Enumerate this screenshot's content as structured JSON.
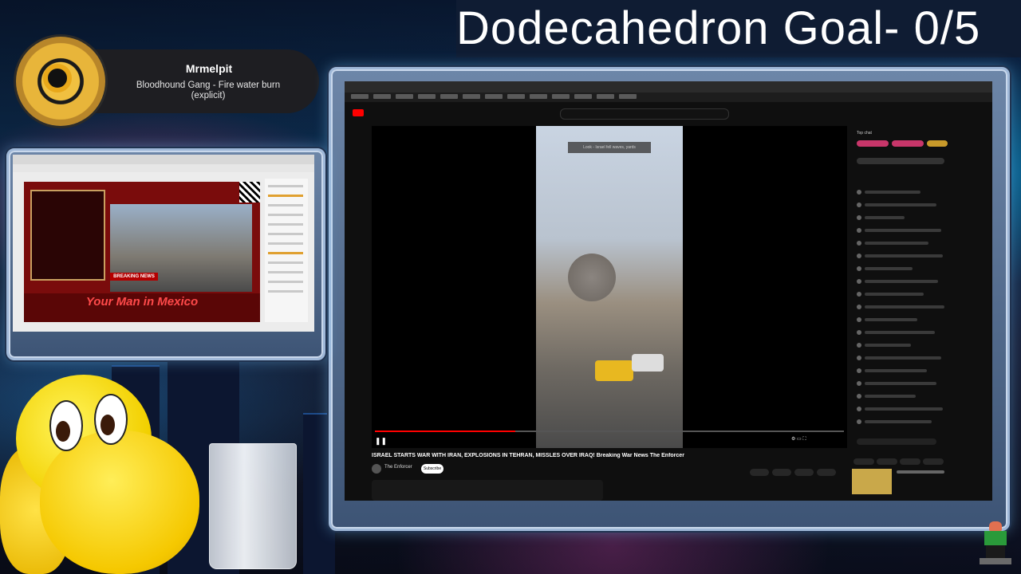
{
  "overlay": {
    "goal_text": "Dodecahedron Goal- 0/5"
  },
  "now_playing": {
    "username": "Mrmelpit",
    "song": "Bloodhound Gang - Fire water burn (explicit)"
  },
  "main_browser": {
    "video_title": "ISRAEL STARTS WAR WITH IRAN, EXPLOSIONS IN TEHRAN, MISSLES OVER IRAQ! Breaking War News The Enforcer",
    "channel_name": "The Enforcer",
    "subscribe_label": "Subscribe",
    "chat_header": "Top chat",
    "video_overlay_text": "Look - Israel fell waves, yards"
  },
  "small_browser": {
    "banner_text": "Your Man in Mexico",
    "breaking_label": "BREAKING NEWS"
  },
  "colors": {
    "yt_red": "#ff0000",
    "goal_bg": "#0f1c33",
    "koopa_yellow": "#f5c800"
  }
}
